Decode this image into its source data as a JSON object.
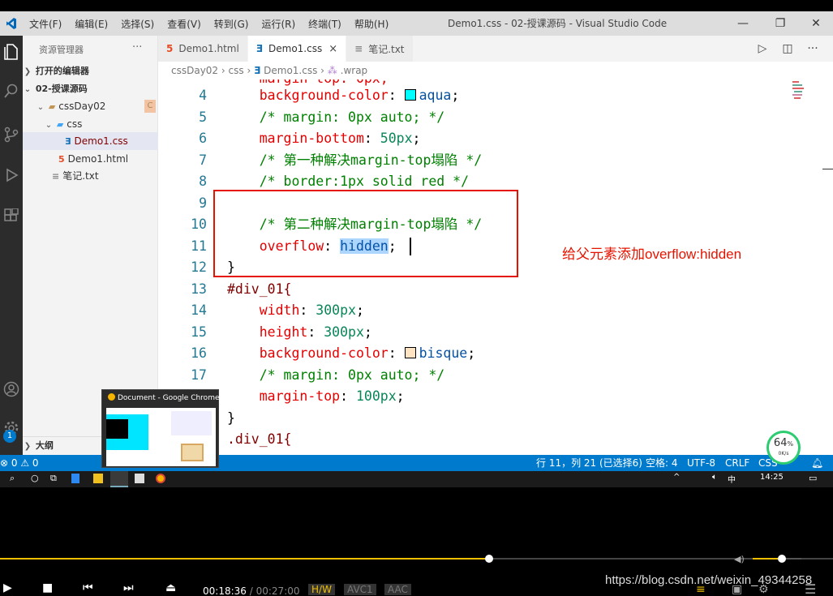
{
  "app": {
    "menu": [
      "文件(F)",
      "编辑(E)",
      "选择(S)",
      "查看(V)",
      "转到(G)",
      "运行(R)",
      "终端(T)",
      "帮助(H)"
    ],
    "window_title": "Demo1.css - 02-授课源码 - Visual Studio Code"
  },
  "sidebar": {
    "title": "资源管理器",
    "more": "···",
    "open_editors": "打开的编辑器",
    "root": "02-授课源码",
    "folder1": "cssDay02",
    "folder1_badge": "C",
    "folder2": "css",
    "file_css": "Demo1.css",
    "file_html": "Demo1.html",
    "file_txt": "笔记.txt",
    "outline": "大纲"
  },
  "tabs": [
    {
      "label": "Demo1.html",
      "icon": "html-file-icon"
    },
    {
      "label": "Demo1.css",
      "icon": "css-file-icon",
      "close": "×"
    },
    {
      "label": "笔记.txt",
      "icon": "text-file-icon"
    }
  ],
  "breadcrumb": {
    "p1": "cssDay02",
    "p2": "css",
    "p3": "Demo1.css",
    "p4": ".wrap"
  },
  "code": {
    "l4": {
      "num": "4",
      "prop": "background-color",
      "val": "aqua"
    },
    "l5": {
      "num": "5",
      "text": "/* margin: 0px auto; */"
    },
    "l6": {
      "num": "6",
      "prop": "margin-bottom",
      "val": "50px"
    },
    "l7": {
      "num": "7",
      "text": "/* 第一种解决margin-top塌陷 */"
    },
    "l8": {
      "num": "8",
      "text": "/* border:1px solid red */"
    },
    "l9": {
      "num": "9"
    },
    "l10": {
      "num": "10",
      "text": "/* 第二种解决margin-top塌陷 */"
    },
    "l11": {
      "num": "11",
      "prop": "overflow",
      "val": "hidden"
    },
    "l12": {
      "num": "12",
      "text": "}"
    },
    "l13": {
      "num": "13",
      "text": "#div_01{"
    },
    "l14": {
      "num": "14",
      "prop": "width",
      "val": "300px"
    },
    "l15": {
      "num": "15",
      "prop": "height",
      "val": "300px"
    },
    "l16": {
      "num": "16",
      "prop": "background-color",
      "val": "bisque"
    },
    "l17": {
      "num": "17",
      "text": "/* margin: 0px auto; */"
    },
    "l18": {
      "prop": "margin-top",
      "val": "100px"
    },
    "l19": {
      "text": "}"
    },
    "l20": {
      "text": ".div_01{"
    }
  },
  "colors": {
    "aqua": "#00ffff",
    "bisque": "#ffe4c4",
    "annotation": "#e51400"
  },
  "annotation": "给父元素添加overflow:hidden",
  "statusbar": {
    "errors": "⊗ 0 ⚠ 0",
    "position": "行 11，列 21 (已选择6)",
    "spaces": "空格: 4",
    "encoding": "UTF-8",
    "eol": "CRLF",
    "lang": "CSS"
  },
  "badge_count": "1",
  "thumbnail": {
    "title": "Document - Google Chrome"
  },
  "perf": {
    "percent": "64",
    "percent_sign": "%",
    "rate": "0K/s"
  },
  "taskbar": {
    "time": "14:25",
    "ime": "中"
  },
  "player": {
    "time_current": "00:18:36",
    "time_sep": "/",
    "time_total": "00:27:00",
    "hw": "H/W",
    "vcodec": "AVC1",
    "acodec": "AAC",
    "watermark": "https://blog.csdn.net/weixin_49344258",
    "progress_fraction": 0.587,
    "volume_fraction": 0.6
  }
}
